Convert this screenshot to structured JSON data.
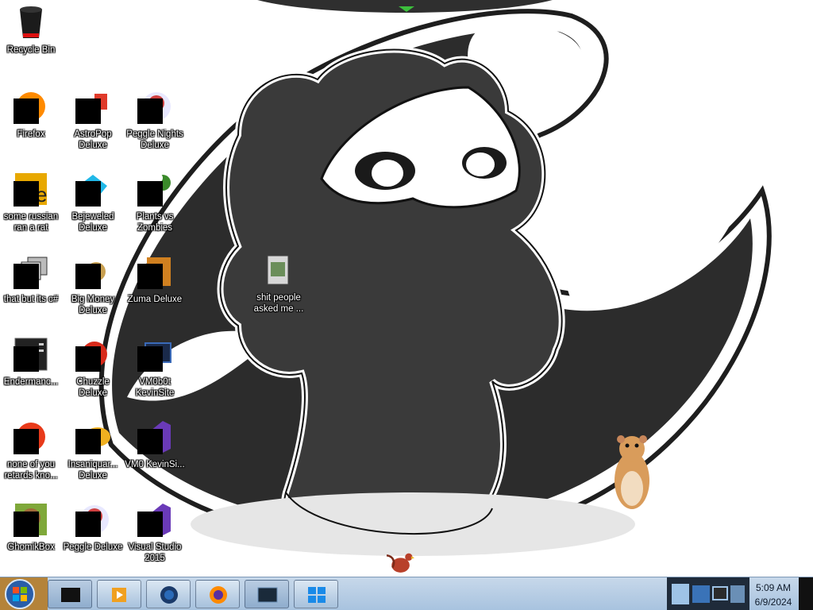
{
  "desktop": {
    "icons": [
      {
        "name": "recycle-bin",
        "label": "Recycle Bin",
        "glyph": "recycle-bin-icon"
      },
      {
        "name": "firefox",
        "label": "Firefox",
        "glyph": "firefox-icon"
      },
      {
        "name": "astropop",
        "label": "AstroPop Deluxe",
        "glyph": "astropop-icon"
      },
      {
        "name": "peggle-nights",
        "label": "Peggle Nights Deluxe",
        "glyph": "peggle-nights-icon"
      },
      {
        "name": "some-russian",
        "label": "some russian ran a rat",
        "glyph": "video-file-icon"
      },
      {
        "name": "bejeweled",
        "label": "Bejeweled Deluxe",
        "glyph": "bejeweled-icon"
      },
      {
        "name": "plants-vs-zombies",
        "label": "Plants vs Zombies",
        "glyph": "plants-vs-zombies-icon"
      },
      {
        "name": "that-but-its-c",
        "label": "that but its c#",
        "glyph": "stacked-windows-icon"
      },
      {
        "name": "big-money",
        "label": "Big Money Deluxe",
        "glyph": "big-money-icon"
      },
      {
        "name": "zuma",
        "label": "Zuma Deluxe",
        "glyph": "zuma-icon"
      },
      {
        "name": "endermanc",
        "label": "Endermanc...",
        "glyph": "terminal-icon"
      },
      {
        "name": "chuzzle",
        "label": "Chuzzle Deluxe",
        "glyph": "chuzzle-icon"
      },
      {
        "name": "vm0b0t-kevinsite",
        "label": "VM0b0t KevinSite",
        "glyph": "monitor-icon"
      },
      {
        "name": "none-of-you",
        "label": "none of you retards kno...",
        "glyph": "media-player-icon"
      },
      {
        "name": "insaniquarium",
        "label": "Insaniquar... Deluxe",
        "glyph": "insaniquarium-icon"
      },
      {
        "name": "vm0-kevinsi",
        "label": "VM0 KevinSi...",
        "glyph": "visual-studio-icon"
      },
      {
        "name": "ghomikbox",
        "label": "GhomikBox",
        "glyph": "hamster-box-icon"
      },
      {
        "name": "peggle-deluxe",
        "label": "Peggle Deluxe",
        "glyph": "peggle-icon"
      },
      {
        "name": "visual-studio",
        "label": "Visual Studio 2015",
        "glyph": "visual-studio-icon"
      },
      {
        "name": "shit-people-asked",
        "label": "shit people asked me ...",
        "glyph": "folder-icon"
      }
    ]
  },
  "taskbar": {
    "start_glyph": "windows-orb-icon",
    "buttons": [
      {
        "glyph": "cmd-window-icon",
        "active": true
      },
      {
        "glyph": "media-player-icon",
        "active": false
      },
      {
        "glyph": "globe-app-icon",
        "active": false
      },
      {
        "glyph": "firefox-icon",
        "active": false
      },
      {
        "glyph": "terminal-window-icon",
        "active": true
      },
      {
        "glyph": "windows-logo-icon",
        "active": false
      }
    ],
    "clock": {
      "time": "5:09 AM",
      "date": "6/9/2024"
    }
  },
  "colors": {
    "taskbar": "#b9cfe6",
    "accent": "#3cbf3c",
    "wallpaper_dark": "#2f2f2f"
  }
}
